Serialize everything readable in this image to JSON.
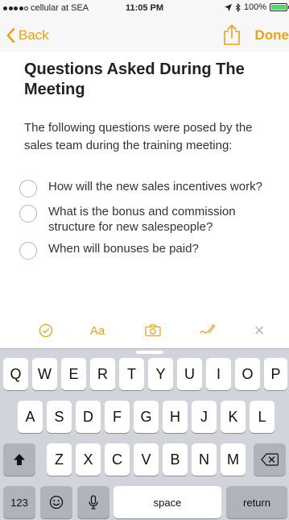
{
  "status_bar": {
    "carrier": "cellular at SEA",
    "time": "11:05 PM",
    "battery": "100%",
    "battery_level": 1.0,
    "signal_bars_filled": 4,
    "signal_bars_total": 5
  },
  "nav": {
    "back_label": "Back",
    "done_label": "Done"
  },
  "note": {
    "title": "Questions Asked During The Meeting",
    "body": "The following questions were posed by the sales team during the training meeting:",
    "checklist": [
      {
        "text": "How will the new sales incentives work?",
        "checked": false
      },
      {
        "text": "What is the bonus and commission structure for new salespeople?",
        "checked": false
      },
      {
        "text": "When will bonuses be paid?",
        "checked": false
      }
    ]
  },
  "format_toolbar": {
    "text_style_label": "Aa",
    "close_label": "×"
  },
  "keyboard": {
    "row1": [
      "Q",
      "W",
      "E",
      "R",
      "T",
      "Y",
      "U",
      "I",
      "O",
      "P"
    ],
    "row2": [
      "A",
      "S",
      "D",
      "F",
      "G",
      "H",
      "J",
      "K",
      "L"
    ],
    "row3": [
      "Z",
      "X",
      "C",
      "V",
      "B",
      "N",
      "M"
    ],
    "numbers_label": "123",
    "space_label": "space",
    "return_label": "return"
  },
  "colors": {
    "accent": "#e5a41a",
    "keyboard_bg": "#d1d4da",
    "battery_green": "#4cd964"
  }
}
